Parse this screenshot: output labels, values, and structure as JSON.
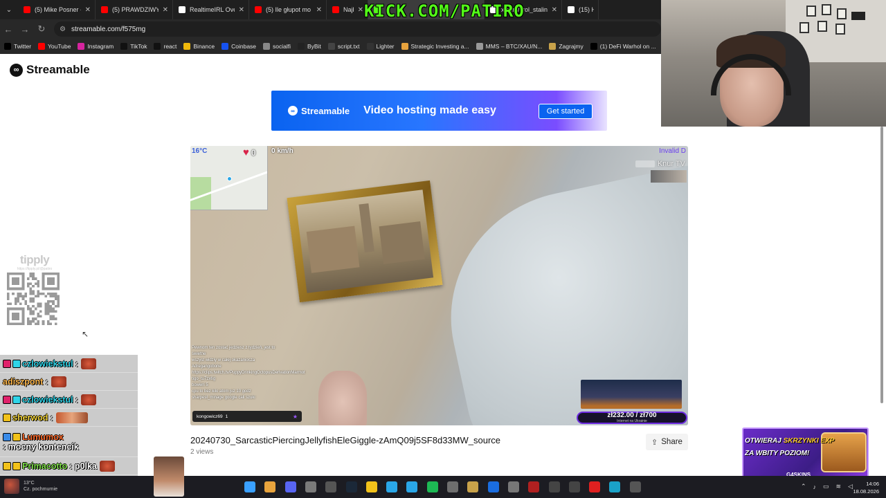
{
  "browser": {
    "tabs": [
      {
        "label": "(5) Mike Posner -",
        "color": "#ff0000"
      },
      {
        "label": "(5) PRAWDZIWY Ł",
        "color": "#ff0000"
      },
      {
        "label": "RealtimeIRL Over",
        "color": "#ffffff"
      },
      {
        "label": "(5) Ile głupot mo",
        "color": "#ff0000"
      },
      {
        "label": "Najbardzie",
        "color": "#ff0000"
      },
      {
        "label": "",
        "color": "#53fc18"
      },
      {
        "label": "x.com/krol_stalin",
        "color": "#ffffff"
      },
      {
        "label": "(15) H",
        "color": "#ffffff"
      }
    ],
    "kick_overlay": "KICK.COM/PATIRO",
    "url": "streamable.com/f575mg",
    "bookmarks": [
      {
        "label": "Twitter",
        "color": "#000000"
      },
      {
        "label": "YouTube",
        "color": "#ff0000"
      },
      {
        "label": "Instagram",
        "color": "#d6249f"
      },
      {
        "label": "TikTok",
        "color": "#111111"
      },
      {
        "label": "react",
        "color": "#111111"
      },
      {
        "label": "Binance",
        "color": "#f0b90b"
      },
      {
        "label": "Coinbase",
        "color": "#1652f0"
      },
      {
        "label": "socialfi",
        "color": "#888888"
      },
      {
        "label": "ByBit",
        "color": "#222222"
      },
      {
        "label": "script.txt",
        "color": "#444444"
      },
      {
        "label": "Lighter",
        "color": "#333333"
      },
      {
        "label": "Strategic Investing a...",
        "color": "#e8a33d"
      },
      {
        "label": "MMS – BTC/XAU/N...",
        "color": "#999999"
      },
      {
        "label": "Zagrajmy",
        "color": "#c8a24a"
      },
      {
        "label": "(1) DeFi Warhol on ...",
        "color": "#000000"
      }
    ]
  },
  "page": {
    "logo": "Streamable",
    "ad": {
      "logo": "Streamable",
      "headline": "Video hosting made easy",
      "cta": "Get started"
    },
    "video": {
      "temperature": "16°C",
      "likes": "0",
      "speed": "0 km/h",
      "invalid_label": "Invalid D",
      "streamer_tag": "Knur TV",
      "chat_user": "kongowicz69",
      "chat_count": "1",
      "donation_amount": "zł232.00 / zł700",
      "donation_subtitle": "Internet na Ukrainie",
      "chat_lines": [
        "Pewnom ten zostać jedziesz z tydzień, jest to",
        "świetne",
        "wszyst widziy w całej okazaniocza",
        "Adregangobone",
        "",
        "https://clips.twitch.tv/PuppyDrinkingOctopusDerivationMarmot",
        "tigo_tu7zx6g",
        "bowwri 5",
        "cpu   to bez kilo atom juz 10 godz",
        "sharpest_minage   google cali szuki"
      ]
    },
    "title": "20240730_SarcasticPiercingJellyfishEleGiggle-zAmQ09j5SF8d33MW_source",
    "views": "2 views",
    "share_label": "Share"
  },
  "overlay": {
    "tippy_logo": "tipply",
    "tippy_url": "https://tipply.pl/@patiro",
    "chat": [
      {
        "name": "czlowiekstul",
        "name_color": "#2fd4e8",
        "badges": [
          "#e0226b",
          "#2fd4e8"
        ],
        "message": ":",
        "emote": "face"
      },
      {
        "name": "adiszpont",
        "name_color": "#ffb84d",
        "badges": [],
        "message": ":",
        "emote": "face"
      },
      {
        "name": "czlowiekstul",
        "name_color": "#2fd4e8",
        "badges": [
          "#e0226b",
          "#2fd4e8"
        ],
        "message": ":",
        "emote": "face"
      },
      {
        "name": "sherwod",
        "name_color": "#f2d33a",
        "badges": [
          "#f2c21a"
        ],
        "message": ":",
        "emote": "wide"
      },
      {
        "name": "Lumumox",
        "name_color": "#ff6a2a",
        "badges": [
          "#3a8be8",
          "#f2c21a"
        ],
        "message": ": mocny kontencik",
        "emote": ""
      },
      {
        "name": "Primacotto",
        "name_color": "#7fe04a",
        "badges": [
          "#f2c21a",
          "#f2c21a"
        ],
        "message": ": p0lka",
        "emote": "face"
      }
    ],
    "skins_line1_a": "OTWIERAJ ",
    "skins_line1_b": "SKRZYNKI EXP",
    "skins_line2": "ZA WBITY POZIOM!",
    "skins_brand": "G4SKINS"
  },
  "taskbar": {
    "weather_temp": "13°C",
    "weather_text": "Cz. pochmurnie",
    "time": "14:06",
    "date": "18.08.2026",
    "apps": [
      {
        "name": "start",
        "color": "#3aa0ff"
      },
      {
        "name": "chrome",
        "color": "#e8a33d"
      },
      {
        "name": "discord",
        "color": "#5865f2"
      },
      {
        "name": "app-3",
        "color": "#7a7a7a"
      },
      {
        "name": "obs",
        "color": "#555555"
      },
      {
        "name": "steam",
        "color": "#1b2838"
      },
      {
        "name": "explorer",
        "color": "#f2c21a"
      },
      {
        "name": "app-7",
        "color": "#2aa7e8"
      },
      {
        "name": "app-8",
        "color": "#2aa7e8"
      },
      {
        "name": "spotify",
        "color": "#1db954"
      },
      {
        "name": "app-10",
        "color": "#6e6e6e"
      },
      {
        "name": "app-11",
        "color": "#c8a24a"
      },
      {
        "name": "app-12",
        "color": "#1a6de0"
      },
      {
        "name": "app-13",
        "color": "#777777"
      },
      {
        "name": "app-14",
        "color": "#b02020"
      },
      {
        "name": "app-15",
        "color": "#444444"
      },
      {
        "name": "app-16",
        "color": "#444444"
      },
      {
        "name": "app-17",
        "color": "#e02020"
      },
      {
        "name": "app-18",
        "color": "#1aa2c8"
      },
      {
        "name": "app-19",
        "color": "#555555"
      }
    ]
  }
}
